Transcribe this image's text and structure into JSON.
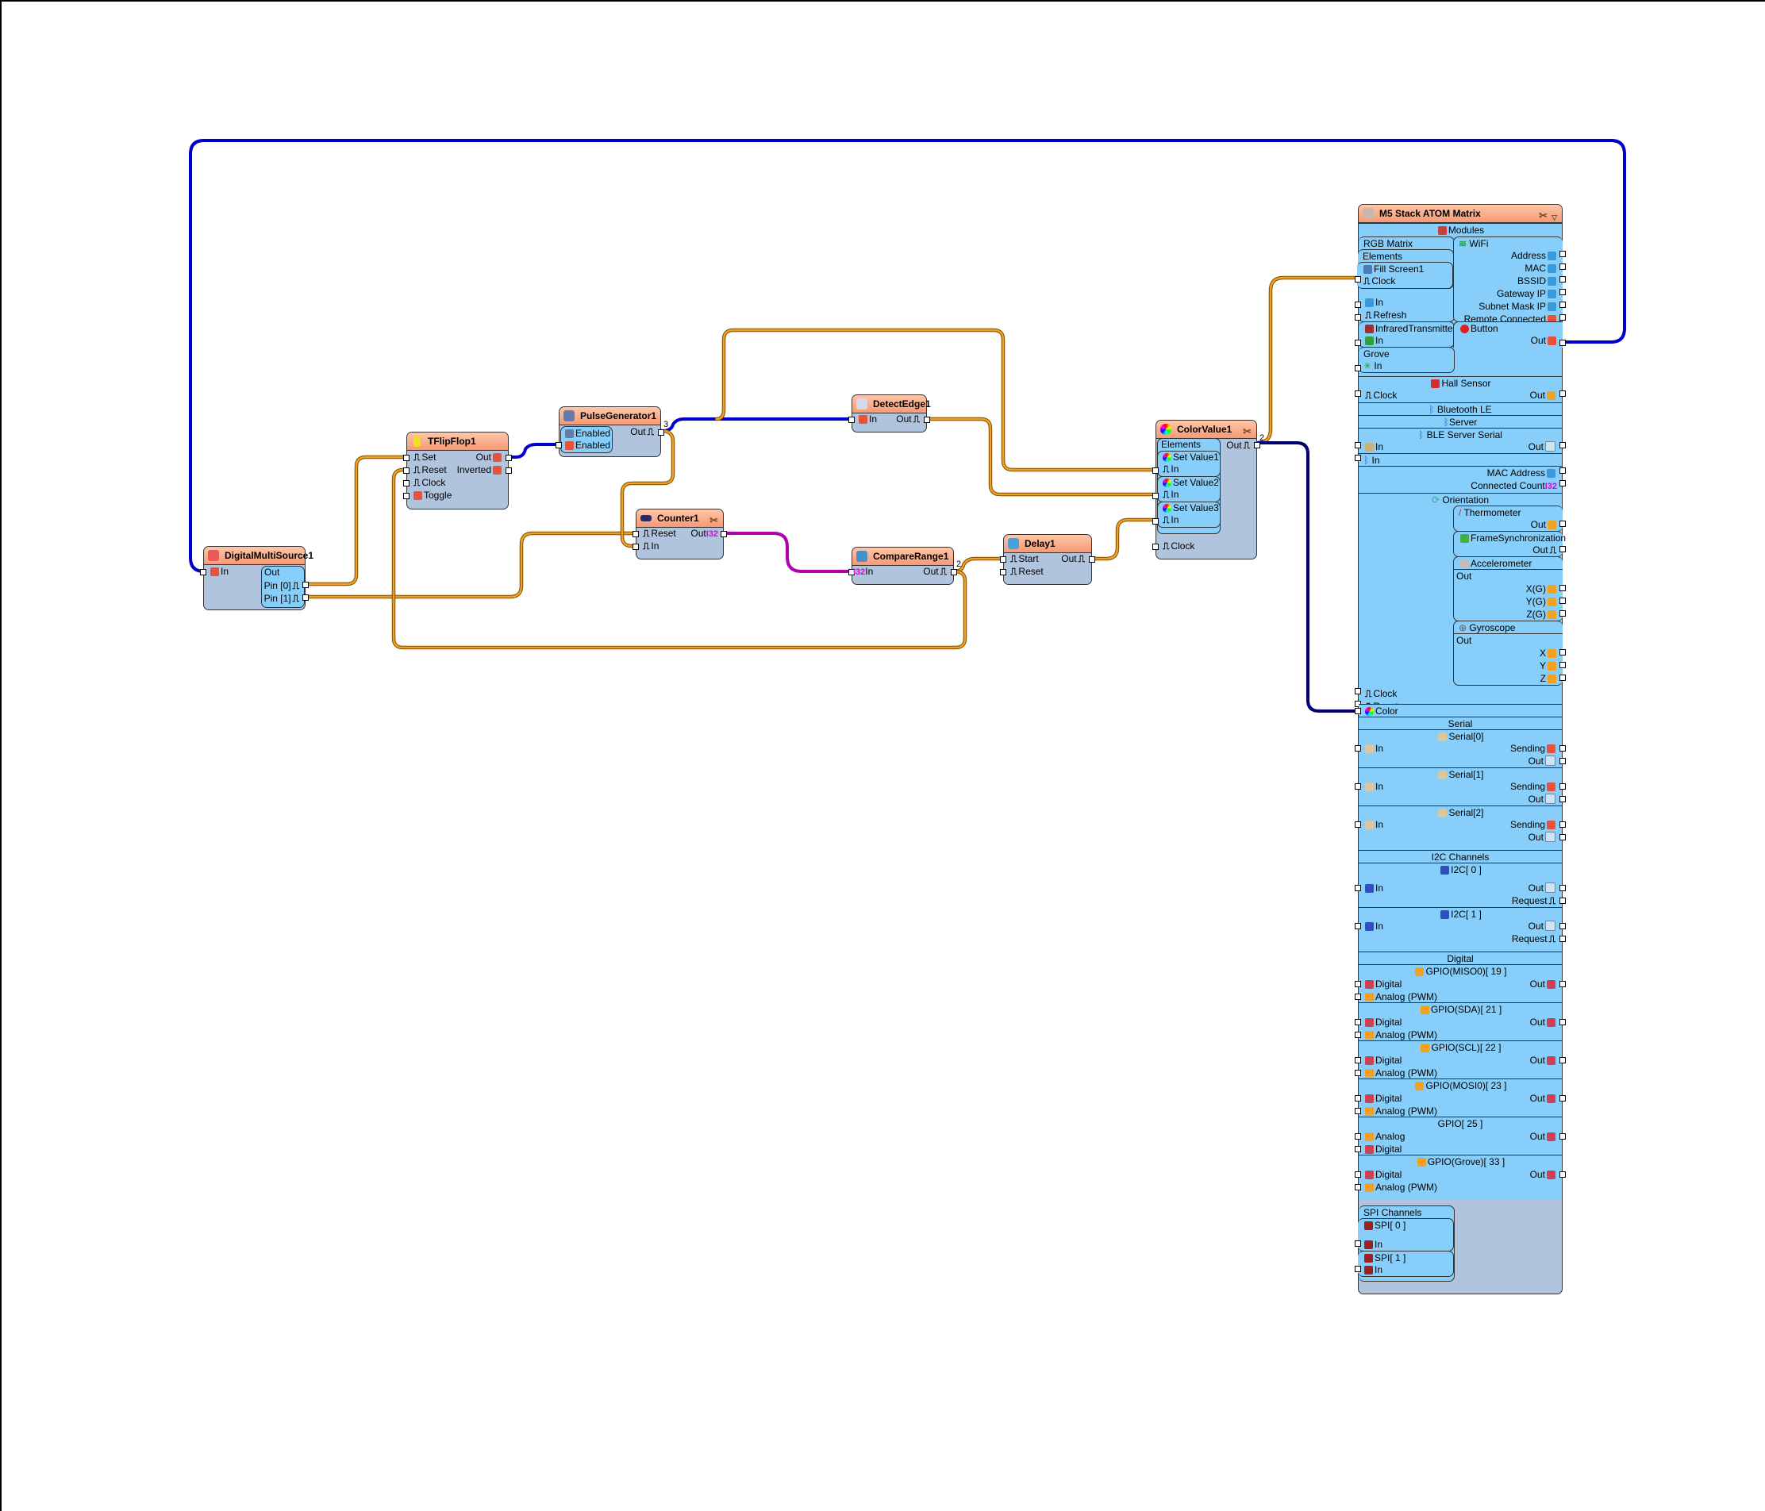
{
  "colors": {
    "wire_digital": "#c0800c",
    "wire_bool": "#0000c8",
    "wire_color": "#000070",
    "wire_int": "#b000b0",
    "component_body": "#b0c4de",
    "component_header": "#f59a76",
    "subpanel": "#87cefa"
  },
  "components": {
    "digitalmultisource": {
      "title": "DigitalMultiSource1",
      "icon": "multi-source-icon",
      "in_label": "In",
      "out_group": "Out",
      "pin0": "Pin [0]",
      "pin1": "Pin [1]"
    },
    "tflipflop": {
      "title": "TFlipFlop1",
      "icon": "flipflop-icon",
      "inputs": [
        "Set",
        "Reset",
        "Clock",
        "Toggle"
      ],
      "outputs": [
        "Out",
        "Inverted"
      ]
    },
    "pulsegenerator": {
      "title": "PulseGenerator1",
      "icon": "pulse-generator-icon",
      "enabled1": "Enabled",
      "enabled2": "Enabled",
      "out": "Out",
      "out_count": "3"
    },
    "detectedge": {
      "title": "DetectEdge1",
      "icon": "detect-edge-icon",
      "in": "In",
      "out": "Out"
    },
    "counter": {
      "title": "Counter1",
      "icon": "counter-icon",
      "reset": "Reset",
      "in": "In",
      "out": "Out",
      "out_type": "I32"
    },
    "comparerange": {
      "title": "CompareRange1",
      "icon": "compare-range-icon",
      "in_type": "I32",
      "in": "In",
      "out": "Out",
      "out_count": "2"
    },
    "delay": {
      "title": "Delay1",
      "icon": "delay-icon",
      "start": "Start",
      "reset": "Reset",
      "out": "Out"
    },
    "colorvalue": {
      "title": "ColorValue1",
      "icon": "color-value-icon",
      "elements": "Elements",
      "set_values": [
        "Set Value1",
        "Set Value2",
        "Set Value3"
      ],
      "in": "In",
      "clock": "Clock",
      "out": "Out",
      "out_count": "2"
    }
  },
  "m5": {
    "title": "M5 Stack ATOM Matrix",
    "modules": "Modules",
    "rgb_matrix": "RGB Matrix",
    "elements": "Elements",
    "fill_screen": "Fill Screen1",
    "clock": "Clock",
    "in": "In",
    "refresh": "Refresh",
    "wifi": "WiFi",
    "wifi_outputs": [
      "Address",
      "MAC",
      "BSSID",
      "Gateway IP",
      "Subnet Mask IP",
      "Remote Connected"
    ],
    "infrared": "InfraredTransmitter",
    "button": "Button",
    "out": "Out",
    "grove": "Grove",
    "hall_sensor": "Hall Sensor",
    "bluetooth_le": "Bluetooth LE",
    "server": "Server",
    "ble_server_serial": "BLE Server Serial",
    "mac_address": "MAC Address",
    "connected_count": "Connected Count",
    "i32": "I32",
    "orientation": "Orientation",
    "thermometer": "Thermometer",
    "frame_sync": "FrameSynchronization",
    "accelerometer": "Accelerometer",
    "accel_outputs": [
      "X(G)",
      "Y(G)",
      "Z(G)"
    ],
    "gyroscope": "Gyroscope",
    "gyro_outputs": [
      "X",
      "Y",
      "Z"
    ],
    "reset": "Reset",
    "color": "Color",
    "serial": "Serial",
    "serial_ports": [
      "Serial[0]",
      "Serial[1]",
      "Serial[2]"
    ],
    "sending": "Sending",
    "i2c_channels": "I2C Channels",
    "i2c_ports": [
      "I2C[ 0 ]",
      "I2C[ 1 ]"
    ],
    "request": "Request",
    "digital": "Digital",
    "gpios": [
      {
        "name": "GPIO(MISO0)[ 19 ]",
        "in1": "Digital",
        "in2": "Analog (PWM)"
      },
      {
        "name": "GPIO(SDA)[ 21 ]",
        "in1": "Digital",
        "in2": "Analog (PWM)"
      },
      {
        "name": "GPIO(SCL)[ 22 ]",
        "in1": "Digital",
        "in2": "Analog (PWM)"
      },
      {
        "name": "GPIO(MOSI0)[ 23 ]",
        "in1": "Digital",
        "in2": "Analog (PWM)"
      },
      {
        "name": "GPIO[ 25 ]",
        "in1": "Analog",
        "in2": "Digital"
      },
      {
        "name": "GPIO(Grove)[ 33 ]",
        "in1": "Digital",
        "in2": "Analog (PWM)"
      }
    ],
    "spi_channels": "SPI Channels",
    "spi_ports": [
      "SPI[ 0 ]",
      "SPI[ 1 ]"
    ]
  }
}
